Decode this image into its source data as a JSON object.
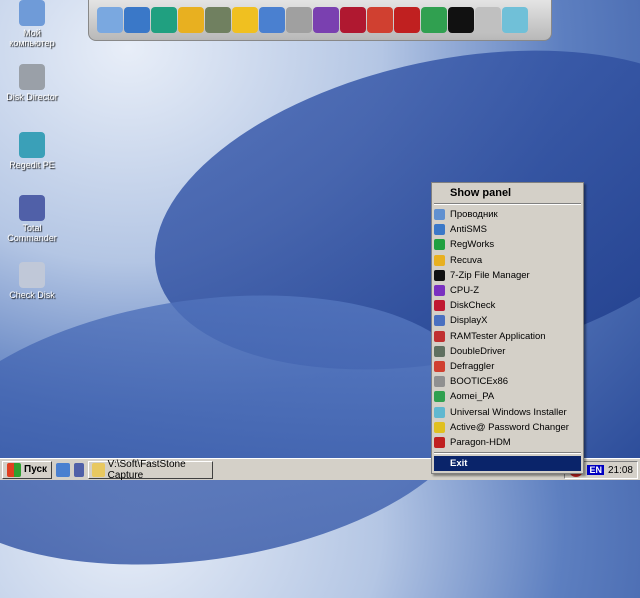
{
  "desktop_icons": [
    {
      "label": "Мой компьютер",
      "icon": "my-computer-icon",
      "color": "#6f9bd8"
    },
    {
      "label": "Disk Director",
      "icon": "disk-director-icon",
      "color": "#9aa0a8"
    },
    {
      "label": "Regedit PE",
      "icon": "regedit-icon",
      "color": "#3aa0b8"
    },
    {
      "label": "Total Commander",
      "icon": "floppy-icon",
      "color": "#5060a8"
    },
    {
      "label": "Check Disk",
      "icon": "check-disk-icon",
      "color": "#c0c8d8"
    }
  ],
  "toolbar": {
    "icons": [
      {
        "name": "explorer-icon",
        "color": "#7aa8e0"
      },
      {
        "name": "antisms-icon",
        "color": "#3a78c8"
      },
      {
        "name": "regworks-icon",
        "color": "#20a080"
      },
      {
        "name": "recuva-icon",
        "color": "#e8b020"
      },
      {
        "name": "doubledriver-icon",
        "color": "#708060"
      },
      {
        "name": "key-icon",
        "color": "#f0c020"
      },
      {
        "name": "displayx-icon",
        "color": "#4a80d0"
      },
      {
        "name": "ramtester-icon",
        "color": "#a0a0a0"
      },
      {
        "name": "cpuz-icon",
        "color": "#7a40b0"
      },
      {
        "name": "diskcheck-icon",
        "color": "#b01830"
      },
      {
        "name": "defraggler-icon",
        "color": "#d04030"
      },
      {
        "name": "paragon-icon",
        "color": "#c02020"
      },
      {
        "name": "aomei-icon",
        "color": "#30a050"
      },
      {
        "name": "7zip-icon",
        "color": "#111111"
      },
      {
        "name": "bootice-icon",
        "color": "#c0c0c0"
      },
      {
        "name": "installer-icon",
        "color": "#70c0d8"
      }
    ]
  },
  "menu": {
    "header": "Show panel",
    "items": [
      {
        "label": "Проводник",
        "color": "#6090d0"
      },
      {
        "label": "AntiSMS",
        "color": "#3a78c8"
      },
      {
        "label": "RegWorks",
        "color": "#20a040"
      },
      {
        "label": "Recuva",
        "color": "#e8b020"
      },
      {
        "label": "7-Zip File Manager",
        "color": "#111111"
      },
      {
        "label": "CPU-Z",
        "color": "#7a30c0"
      },
      {
        "label": "DiskCheck",
        "color": "#c01830"
      },
      {
        "label": "DisplayX",
        "color": "#4a70c0"
      },
      {
        "label": "RAMTester Application",
        "color": "#c03030"
      },
      {
        "label": "DoubleDriver",
        "color": "#607060"
      },
      {
        "label": "Defraggler",
        "color": "#d04030"
      },
      {
        "label": "BOOTICEx86",
        "color": "#909090"
      },
      {
        "label": "Aomei_PA",
        "color": "#30a050"
      },
      {
        "label": "Universal Windows Installer",
        "color": "#60b8d0"
      },
      {
        "label": "Active@ Password Changer",
        "color": "#e0c020"
      },
      {
        "label": "Paragon-HDM",
        "color": "#c02020"
      }
    ],
    "exit": "Exit"
  },
  "taskbar": {
    "start": "Пуск",
    "task": "V:\\Soft\\FastStone Capture",
    "lang": "EN",
    "clock": "21:08"
  }
}
